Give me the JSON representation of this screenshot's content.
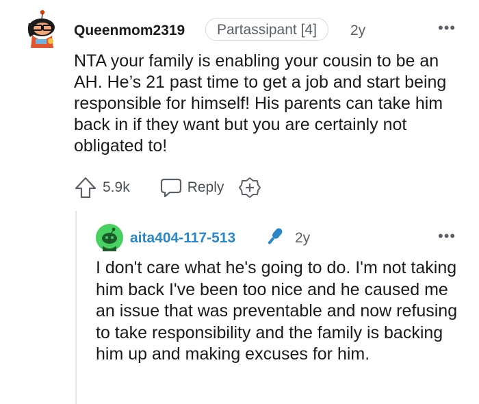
{
  "comment": {
    "username": "Queenmom2319",
    "flair": "Partassipant [4]",
    "time": "2y",
    "more": "•••",
    "body": "NTA your family is enabling your cousin to be an AH. He’s 21 past time to get a job and start being responsible for himself! His parents can take him back in if they want but you are certainly not obligated to!",
    "score": "5.9k",
    "reply_label": "Reply"
  },
  "reply": {
    "username": "aita404-117-513",
    "time": "2y",
    "more": "•••",
    "body": "I don't care what he's going to do. I'm not taking him back I've been too nice and he caused me an issue that was preventable and now refusing to take responsibility and the family is backing him up and making excuses for him."
  },
  "colors": {
    "op_username": "#2a87c7",
    "muted": "#5b6066",
    "text": "#1a1a1b",
    "op_badge": "#2a87c7"
  },
  "icons": [
    "snoo-avatar-icon",
    "upvote-icon",
    "reply-icon",
    "award-icon",
    "snoo-default-avatar-icon",
    "op-microphone-icon",
    "more-options-icon"
  ]
}
